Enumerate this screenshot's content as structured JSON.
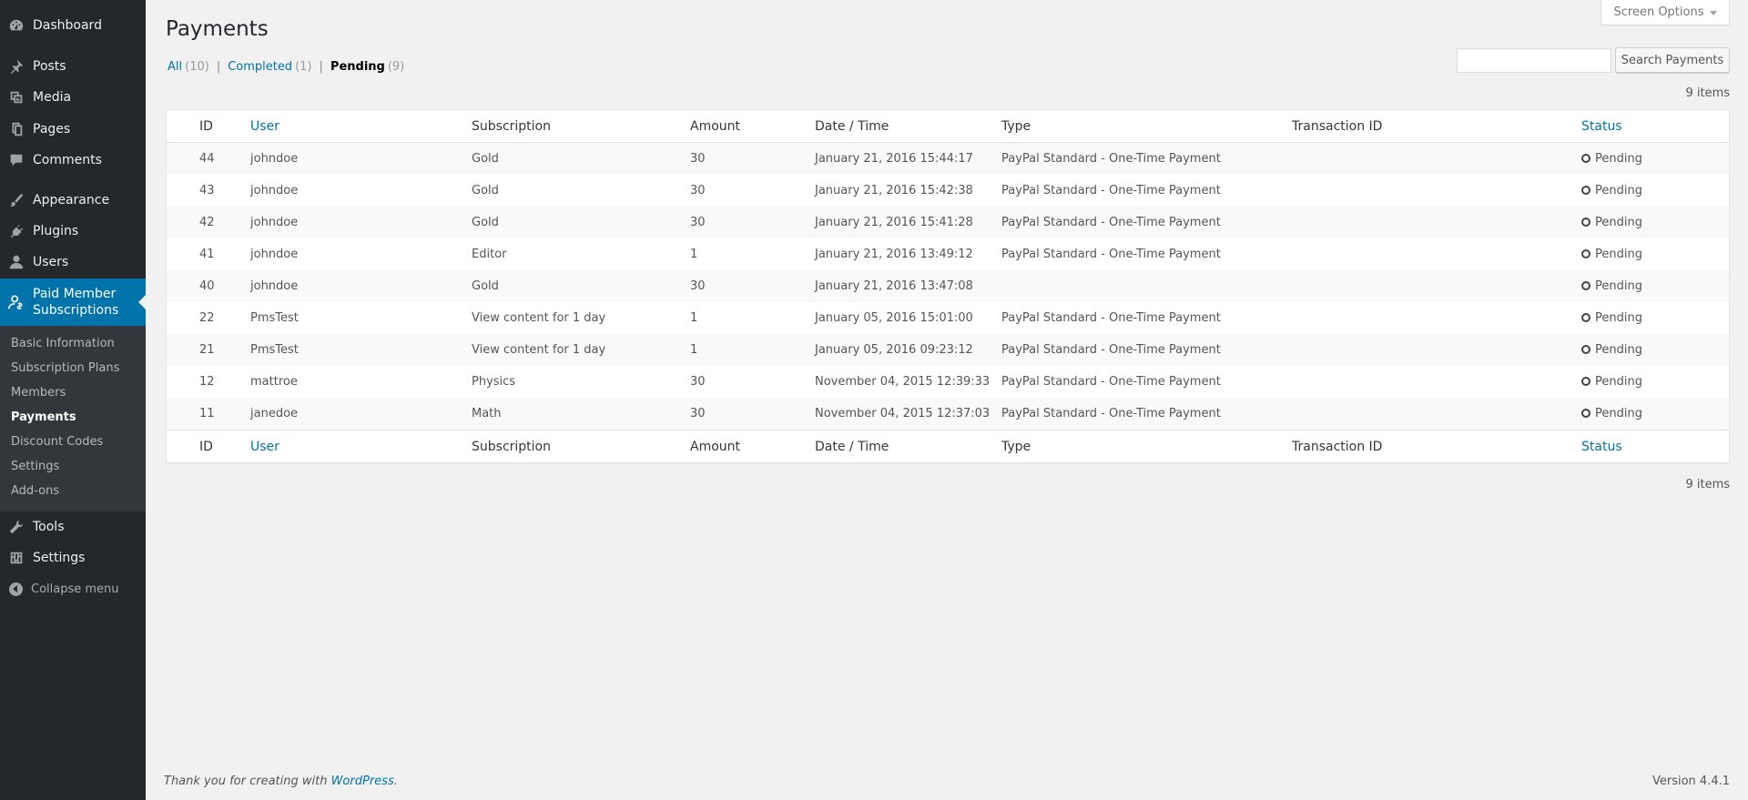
{
  "sidebar": {
    "menu": [
      {
        "label": "Dashboard",
        "icon": "dashboard-icon"
      },
      {
        "label": "Posts",
        "icon": "pin-icon"
      },
      {
        "label": "Media",
        "icon": "media-icon"
      },
      {
        "label": "Pages",
        "icon": "pages-icon"
      },
      {
        "label": "Comments",
        "icon": "comment-icon"
      },
      {
        "label": "Appearance",
        "icon": "brush-icon"
      },
      {
        "label": "Plugins",
        "icon": "plug-icon"
      },
      {
        "label": "Users",
        "icon": "user-icon"
      },
      {
        "label": "Paid Member Subscriptions",
        "icon": "member-icon"
      },
      {
        "label": "Tools",
        "icon": "wrench-icon"
      },
      {
        "label": "Settings",
        "icon": "settings-icon"
      }
    ],
    "submenu": [
      "Basic Information",
      "Subscription Plans",
      "Members",
      "Payments",
      "Discount Codes",
      "Settings",
      "Add-ons"
    ],
    "collapse_label": "Collapse menu"
  },
  "header": {
    "title": "Payments",
    "screen_options": "Screen Options",
    "search_button": "Search Payments",
    "search_value": ""
  },
  "filters": [
    {
      "label": "All",
      "count": "(10)"
    },
    {
      "label": "Completed",
      "count": "(1)"
    },
    {
      "label": "Pending",
      "count": "(9)"
    }
  ],
  "items_count": "9 items",
  "table": {
    "columns": [
      "ID",
      "User",
      "Subscription",
      "Amount",
      "Date / Time",
      "Type",
      "Transaction ID",
      "Status"
    ],
    "rows": [
      {
        "id": "44",
        "user": "johndoe",
        "subscription": "Gold",
        "amount": "30",
        "date": "January 21, 2016 15:44:17",
        "type": "PayPal Standard - One-Time Payment",
        "txn": "",
        "status": "Pending"
      },
      {
        "id": "43",
        "user": "johndoe",
        "subscription": "Gold",
        "amount": "30",
        "date": "January 21, 2016 15:42:38",
        "type": "PayPal Standard - One-Time Payment",
        "txn": "",
        "status": "Pending"
      },
      {
        "id": "42",
        "user": "johndoe",
        "subscription": "Gold",
        "amount": "30",
        "date": "January 21, 2016 15:41:28",
        "type": "PayPal Standard - One-Time Payment",
        "txn": "",
        "status": "Pending"
      },
      {
        "id": "41",
        "user": "johndoe",
        "subscription": "Editor",
        "amount": "1",
        "date": "January 21, 2016 13:49:12",
        "type": "PayPal Standard - One-Time Payment",
        "txn": "",
        "status": "Pending"
      },
      {
        "id": "40",
        "user": "johndoe",
        "subscription": "Gold",
        "amount": "30",
        "date": "January 21, 2016 13:47:08",
        "type": "",
        "txn": "",
        "status": "Pending"
      },
      {
        "id": "22",
        "user": "PmsTest",
        "subscription": "View content for 1 day",
        "amount": "1",
        "date": "January 05, 2016 15:01:00",
        "type": "PayPal Standard - One-Time Payment",
        "txn": "",
        "status": "Pending"
      },
      {
        "id": "21",
        "user": "PmsTest",
        "subscription": "View content for 1 day",
        "amount": "1",
        "date": "January 05, 2016 09:23:12",
        "type": "PayPal Standard - One-Time Payment",
        "txn": "",
        "status": "Pending"
      },
      {
        "id": "12",
        "user": "mattroe",
        "subscription": "Physics",
        "amount": "30",
        "date": "November 04, 2015 12:39:33",
        "type": "PayPal Standard - One-Time Payment",
        "txn": "",
        "status": "Pending"
      },
      {
        "id": "11",
        "user": "janedoe",
        "subscription": "Math",
        "amount": "30",
        "date": "November 04, 2015 12:37:03",
        "type": "PayPal Standard - One-Time Payment",
        "txn": "",
        "status": "Pending"
      }
    ]
  },
  "footer": {
    "thanks_prefix": "Thank you for creating with ",
    "thanks_link": "WordPress",
    "thanks_suffix": ".",
    "version": "Version 4.4.1"
  }
}
